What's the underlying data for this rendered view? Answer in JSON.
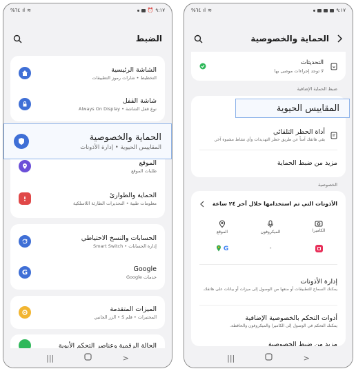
{
  "left_phone": {
    "status": {
      "time": "٩:١٧",
      "battery": "٦٤%"
    },
    "header": {
      "title": "الضبط"
    },
    "items": [
      {
        "title": "الشاشة الرئيسية",
        "subtitle": "التخطيط • شارات رموز التطبيقات"
      },
      {
        "title": "شاشة القفل",
        "subtitle": "نوع قفل الشاشة • Always On Display"
      },
      {
        "title": "الحماية والخصوصية",
        "subtitle": "المقاييس الحيوية • إدارة الأذونات"
      },
      {
        "title": "الموقع",
        "subtitle": "طلبات الموقع"
      },
      {
        "title": "الحماية والطوارئ",
        "subtitle": "معلومات طبية • التحذيرات الطارئة اللاسلكية"
      },
      {
        "title": "الحسابات والنسخ الاحتياطي",
        "subtitle": "إدارة الحسابات • Smart Switch"
      },
      {
        "title": "Google",
        "subtitle": "خدمات Google"
      },
      {
        "title": "الميزات المتقدمة",
        "subtitle": "المختبرات • قلم S • الزر الجانبي"
      },
      {
        "title": "الحالة الرقمية وعناصر التحكم الأبوية",
        "subtitle": ""
      }
    ]
  },
  "right_phone": {
    "status": {
      "time": "٩:١٧",
      "battery": "٦٤%"
    },
    "header": {
      "title": "الحماية والخصوصية"
    },
    "updates": {
      "title": "التحديثات",
      "subtitle": "لا توجد إجراءات موصى بها"
    },
    "section_extra": "ضبط الحماية الإضافية",
    "biometrics": {
      "title": "المقاييس الحيوية"
    },
    "auto_blocker": {
      "title": "أداة الحظر التلقائي",
      "subtitle": "يقي هاتفك آمناً عن طريق حظر التهديدات وأي نشاط مشبوه آخر."
    },
    "more_security": {
      "title": "مزيد من ضبط الحماية"
    },
    "section_privacy": "الخصوصية",
    "permissions_used": {
      "title": "الأذونات التي تم استخدامها خلال آخر ٢٤ ساعة",
      "columns": [
        {
          "label": "الكاميرا",
          "app": ""
        },
        {
          "label": "الميكروفون",
          "app": "-"
        },
        {
          "label": "الموقع",
          "app": ""
        }
      ]
    },
    "permission_manager": {
      "title": "إدارة الأذونات",
      "subtitle": "يمكنك السماح للتطبيقات أو منعها من الوصول إلى ميزات أو بيانات على هاتفك."
    },
    "extra_privacy": {
      "title": "أدوات التحكم بالخصوصية الإضافية",
      "subtitle": "يمكنك التحكم في الوصول إلى الكاميرا والميكروفون والحافظة."
    },
    "more_privacy": {
      "title": "مزيد من ضبط الخصوصية"
    }
  },
  "colors": {
    "accent": "#3f6fd6",
    "highlight_border": "#8fb4ea",
    "location": "#6b4fd8",
    "emergency": "#e04848",
    "advanced": "#f2b530",
    "status_ok": "#2fb85a"
  }
}
